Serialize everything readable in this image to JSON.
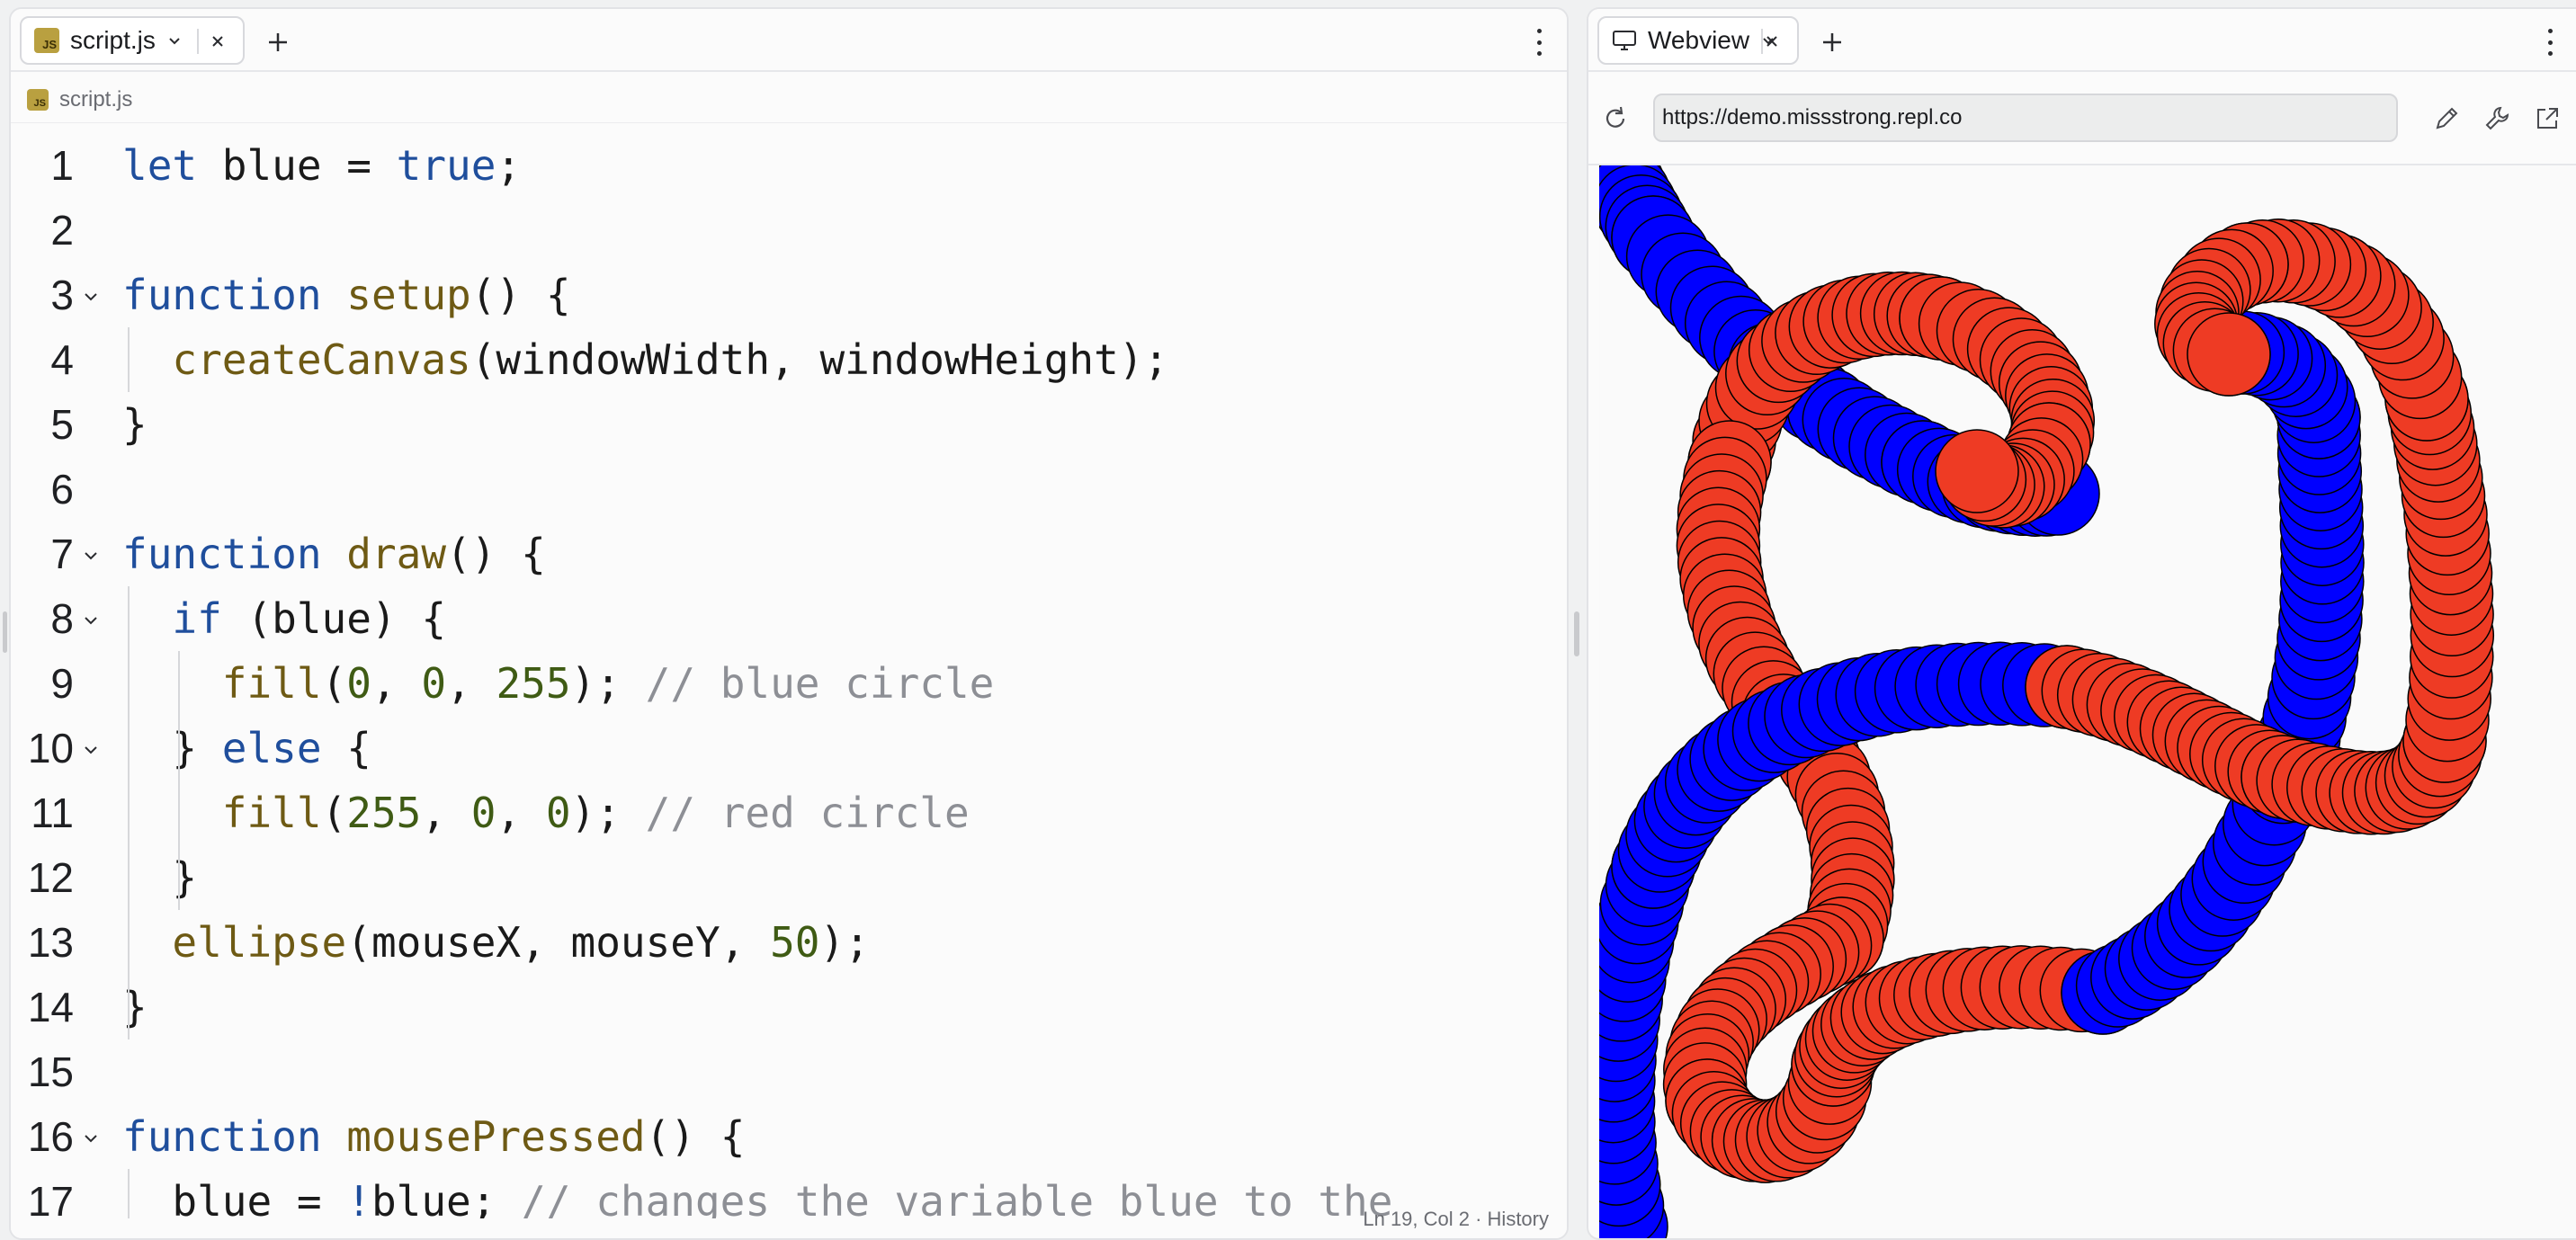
{
  "editor": {
    "tab_label": "script.js",
    "badge_text": "JS",
    "breadcrumb": "script.js",
    "status": "Ln 19, Col 2 · History",
    "lines": [
      {
        "n": "1",
        "fold": false,
        "tokens": [
          [
            "kw",
            "let"
          ],
          [
            "pl",
            " blue = "
          ],
          [
            "kw",
            "true"
          ],
          [
            "pl",
            ";"
          ]
        ]
      },
      {
        "n": "2",
        "fold": false,
        "tokens": []
      },
      {
        "n": "3",
        "fold": true,
        "tokens": [
          [
            "kw",
            "function"
          ],
          [
            "pl",
            " "
          ],
          [
            "fn",
            "setup"
          ],
          [
            "pl",
            "() {"
          ]
        ]
      },
      {
        "n": "4",
        "fold": false,
        "tokens": [
          [
            "pl",
            "  "
          ],
          [
            "fn",
            "createCanvas"
          ],
          [
            "pl",
            "(windowWidth, windowHeight);"
          ]
        ]
      },
      {
        "n": "5",
        "fold": false,
        "tokens": [
          [
            "pl",
            "}"
          ]
        ]
      },
      {
        "n": "6",
        "fold": false,
        "tokens": []
      },
      {
        "n": "7",
        "fold": true,
        "tokens": [
          [
            "kw",
            "function"
          ],
          [
            "pl",
            " "
          ],
          [
            "fn",
            "draw"
          ],
          [
            "pl",
            "() {"
          ]
        ]
      },
      {
        "n": "8",
        "fold": true,
        "tokens": [
          [
            "pl",
            "  "
          ],
          [
            "kw",
            "if"
          ],
          [
            "pl",
            " (blue) {"
          ]
        ]
      },
      {
        "n": "9",
        "fold": false,
        "tokens": [
          [
            "pl",
            "    "
          ],
          [
            "fn",
            "fill"
          ],
          [
            "pl",
            "("
          ],
          [
            "num",
            "0"
          ],
          [
            "pl",
            ", "
          ],
          [
            "num",
            "0"
          ],
          [
            "pl",
            ", "
          ],
          [
            "num",
            "255"
          ],
          [
            "pl",
            "); "
          ],
          [
            "cm",
            "// blue circle"
          ]
        ]
      },
      {
        "n": "10",
        "fold": true,
        "tokens": [
          [
            "pl",
            "  } "
          ],
          [
            "kw",
            "else"
          ],
          [
            "pl",
            " {"
          ]
        ]
      },
      {
        "n": "11",
        "fold": false,
        "tokens": [
          [
            "pl",
            "    "
          ],
          [
            "fn",
            "fill"
          ],
          [
            "pl",
            "("
          ],
          [
            "num",
            "255"
          ],
          [
            "pl",
            ", "
          ],
          [
            "num",
            "0"
          ],
          [
            "pl",
            ", "
          ],
          [
            "num",
            "0"
          ],
          [
            "pl",
            "); "
          ],
          [
            "cm",
            "// red circle"
          ]
        ]
      },
      {
        "n": "12",
        "fold": false,
        "tokens": [
          [
            "pl",
            "  }"
          ]
        ]
      },
      {
        "n": "13",
        "fold": false,
        "tokens": [
          [
            "pl",
            "  "
          ],
          [
            "fn",
            "ellipse"
          ],
          [
            "pl",
            "(mouseX, mouseY, "
          ],
          [
            "num",
            "50"
          ],
          [
            "pl",
            ");"
          ]
        ]
      },
      {
        "n": "14",
        "fold": false,
        "tokens": [
          [
            "pl",
            "}"
          ]
        ]
      },
      {
        "n": "15",
        "fold": false,
        "tokens": []
      },
      {
        "n": "16",
        "fold": true,
        "tokens": [
          [
            "kw",
            "function"
          ],
          [
            "pl",
            " "
          ],
          [
            "fn",
            "mousePressed"
          ],
          [
            "pl",
            "() {"
          ]
        ]
      },
      {
        "n": "17",
        "fold": false,
        "tokens": [
          [
            "pl",
            "  blue = "
          ],
          [
            "kw",
            "!"
          ],
          [
            "pl",
            "blue; "
          ],
          [
            "cm",
            "// changes the variable blue to the"
          ]
        ]
      }
    ]
  },
  "webview": {
    "tab_label": "Webview",
    "url": "https://demo.missstrong.repl.co",
    "icons": [
      "reload-icon",
      "edit-icon",
      "devtools-icon",
      "open-new-window-icon"
    ]
  },
  "colors": {
    "keyword": "#1f4e9c",
    "function": "#6e5a14",
    "number": "#3f5b14",
    "comment": "#8d8f95",
    "blue_circle": "#0000ff",
    "red_circle": "#ee3b24"
  }
}
